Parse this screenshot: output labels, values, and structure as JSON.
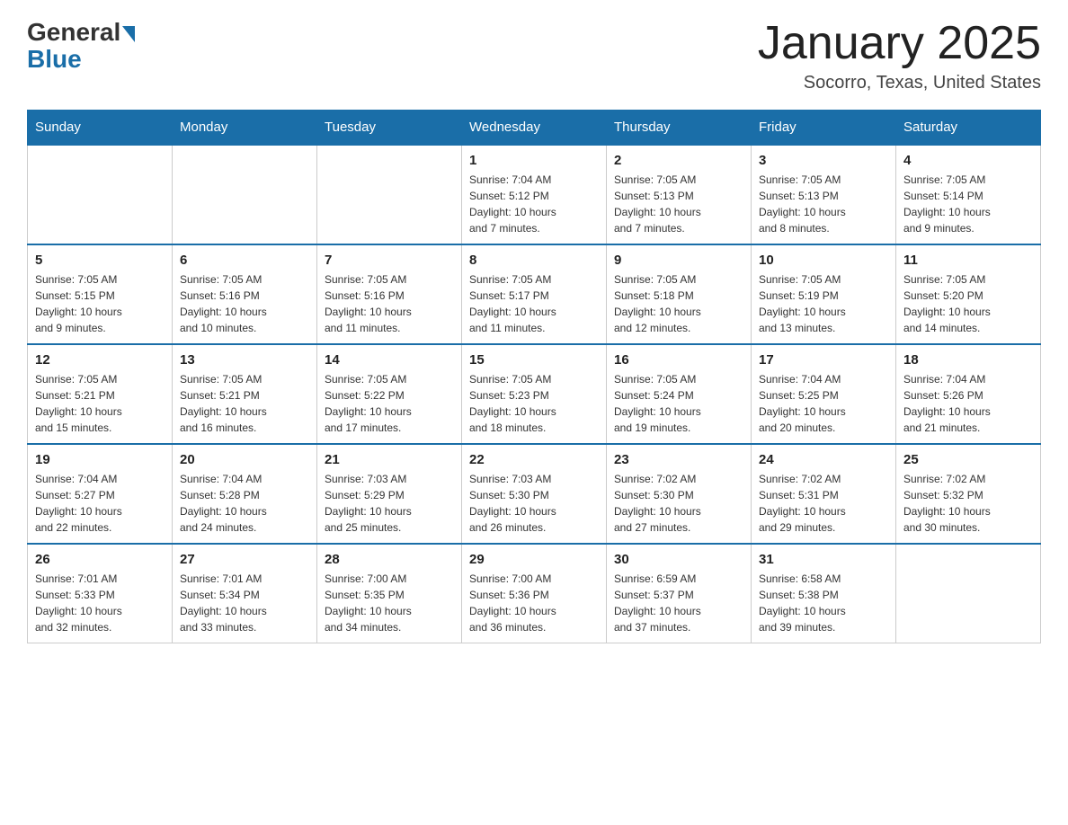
{
  "logo": {
    "general": "General",
    "blue": "Blue"
  },
  "title": "January 2025",
  "location": "Socorro, Texas, United States",
  "days_of_week": [
    "Sunday",
    "Monday",
    "Tuesday",
    "Wednesday",
    "Thursday",
    "Friday",
    "Saturday"
  ],
  "weeks": [
    [
      {
        "day": "",
        "info": ""
      },
      {
        "day": "",
        "info": ""
      },
      {
        "day": "",
        "info": ""
      },
      {
        "day": "1",
        "info": "Sunrise: 7:04 AM\nSunset: 5:12 PM\nDaylight: 10 hours\nand 7 minutes."
      },
      {
        "day": "2",
        "info": "Sunrise: 7:05 AM\nSunset: 5:13 PM\nDaylight: 10 hours\nand 7 minutes."
      },
      {
        "day": "3",
        "info": "Sunrise: 7:05 AM\nSunset: 5:13 PM\nDaylight: 10 hours\nand 8 minutes."
      },
      {
        "day": "4",
        "info": "Sunrise: 7:05 AM\nSunset: 5:14 PM\nDaylight: 10 hours\nand 9 minutes."
      }
    ],
    [
      {
        "day": "5",
        "info": "Sunrise: 7:05 AM\nSunset: 5:15 PM\nDaylight: 10 hours\nand 9 minutes."
      },
      {
        "day": "6",
        "info": "Sunrise: 7:05 AM\nSunset: 5:16 PM\nDaylight: 10 hours\nand 10 minutes."
      },
      {
        "day": "7",
        "info": "Sunrise: 7:05 AM\nSunset: 5:16 PM\nDaylight: 10 hours\nand 11 minutes."
      },
      {
        "day": "8",
        "info": "Sunrise: 7:05 AM\nSunset: 5:17 PM\nDaylight: 10 hours\nand 11 minutes."
      },
      {
        "day": "9",
        "info": "Sunrise: 7:05 AM\nSunset: 5:18 PM\nDaylight: 10 hours\nand 12 minutes."
      },
      {
        "day": "10",
        "info": "Sunrise: 7:05 AM\nSunset: 5:19 PM\nDaylight: 10 hours\nand 13 minutes."
      },
      {
        "day": "11",
        "info": "Sunrise: 7:05 AM\nSunset: 5:20 PM\nDaylight: 10 hours\nand 14 minutes."
      }
    ],
    [
      {
        "day": "12",
        "info": "Sunrise: 7:05 AM\nSunset: 5:21 PM\nDaylight: 10 hours\nand 15 minutes."
      },
      {
        "day": "13",
        "info": "Sunrise: 7:05 AM\nSunset: 5:21 PM\nDaylight: 10 hours\nand 16 minutes."
      },
      {
        "day": "14",
        "info": "Sunrise: 7:05 AM\nSunset: 5:22 PM\nDaylight: 10 hours\nand 17 minutes."
      },
      {
        "day": "15",
        "info": "Sunrise: 7:05 AM\nSunset: 5:23 PM\nDaylight: 10 hours\nand 18 minutes."
      },
      {
        "day": "16",
        "info": "Sunrise: 7:05 AM\nSunset: 5:24 PM\nDaylight: 10 hours\nand 19 minutes."
      },
      {
        "day": "17",
        "info": "Sunrise: 7:04 AM\nSunset: 5:25 PM\nDaylight: 10 hours\nand 20 minutes."
      },
      {
        "day": "18",
        "info": "Sunrise: 7:04 AM\nSunset: 5:26 PM\nDaylight: 10 hours\nand 21 minutes."
      }
    ],
    [
      {
        "day": "19",
        "info": "Sunrise: 7:04 AM\nSunset: 5:27 PM\nDaylight: 10 hours\nand 22 minutes."
      },
      {
        "day": "20",
        "info": "Sunrise: 7:04 AM\nSunset: 5:28 PM\nDaylight: 10 hours\nand 24 minutes."
      },
      {
        "day": "21",
        "info": "Sunrise: 7:03 AM\nSunset: 5:29 PM\nDaylight: 10 hours\nand 25 minutes."
      },
      {
        "day": "22",
        "info": "Sunrise: 7:03 AM\nSunset: 5:30 PM\nDaylight: 10 hours\nand 26 minutes."
      },
      {
        "day": "23",
        "info": "Sunrise: 7:02 AM\nSunset: 5:30 PM\nDaylight: 10 hours\nand 27 minutes."
      },
      {
        "day": "24",
        "info": "Sunrise: 7:02 AM\nSunset: 5:31 PM\nDaylight: 10 hours\nand 29 minutes."
      },
      {
        "day": "25",
        "info": "Sunrise: 7:02 AM\nSunset: 5:32 PM\nDaylight: 10 hours\nand 30 minutes."
      }
    ],
    [
      {
        "day": "26",
        "info": "Sunrise: 7:01 AM\nSunset: 5:33 PM\nDaylight: 10 hours\nand 32 minutes."
      },
      {
        "day": "27",
        "info": "Sunrise: 7:01 AM\nSunset: 5:34 PM\nDaylight: 10 hours\nand 33 minutes."
      },
      {
        "day": "28",
        "info": "Sunrise: 7:00 AM\nSunset: 5:35 PM\nDaylight: 10 hours\nand 34 minutes."
      },
      {
        "day": "29",
        "info": "Sunrise: 7:00 AM\nSunset: 5:36 PM\nDaylight: 10 hours\nand 36 minutes."
      },
      {
        "day": "30",
        "info": "Sunrise: 6:59 AM\nSunset: 5:37 PM\nDaylight: 10 hours\nand 37 minutes."
      },
      {
        "day": "31",
        "info": "Sunrise: 6:58 AM\nSunset: 5:38 PM\nDaylight: 10 hours\nand 39 minutes."
      },
      {
        "day": "",
        "info": ""
      }
    ]
  ]
}
